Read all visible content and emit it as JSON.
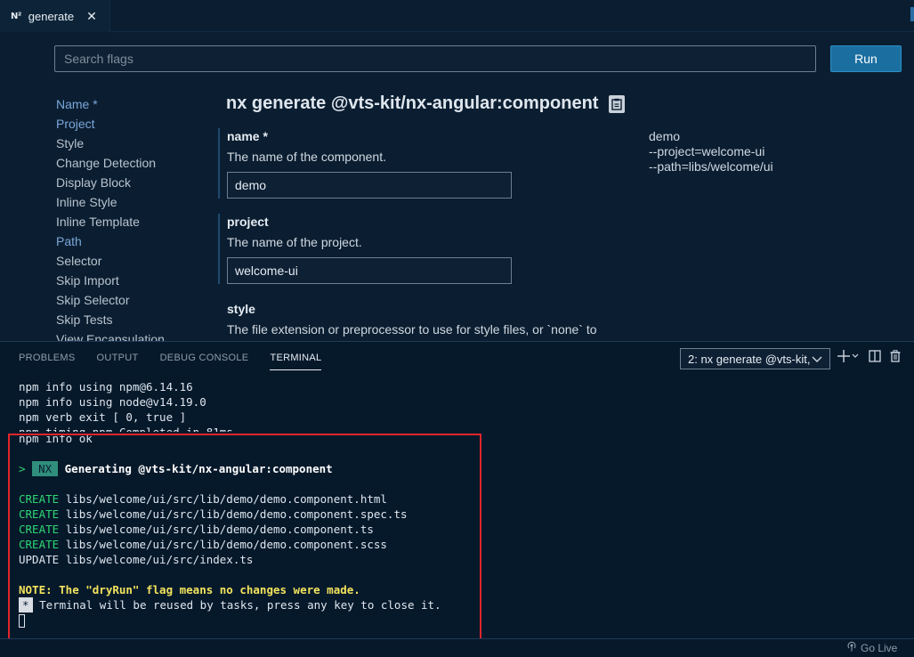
{
  "tab": {
    "logo": "N²",
    "label": "generate",
    "close": "✕"
  },
  "search": {
    "placeholder": "Search flags",
    "value": ""
  },
  "run_label": "Run",
  "nav": [
    "Name *",
    "Project",
    "Style",
    "Change Detection",
    "Display Block",
    "Inline Style",
    "Inline Template",
    "Path",
    "Selector",
    "Skip Import",
    "Skip Selector",
    "Skip Tests",
    "View Encapsulation"
  ],
  "nav_active": [
    "Name *",
    "Project",
    "Path"
  ],
  "title": "nx generate @vts-kit/nx-angular:component",
  "fields": [
    {
      "name": "name *",
      "description": "The name of the component.",
      "value": "demo"
    },
    {
      "name": "project",
      "description": "The name of the project.",
      "value": "welcome-ui"
    },
    {
      "name": "style",
      "description": "The file extension or preprocessor to use for style files, or `none` to skip generating the style file."
    }
  ],
  "preview": [
    "demo",
    "--project=welcome-ui",
    "--path=libs/welcome/ui"
  ],
  "panel_tabs": [
    "PROBLEMS",
    "OUTPUT",
    "DEBUG CONSOLE",
    "TERMINAL"
  ],
  "terminal_select": "2: nx generate @vts-kit,",
  "terminal_lines": [
    "npm info using npm@6.14.16",
    "npm info using node@v14.19.0",
    "npm verb exit [ 0, true ]",
    "npm timing npm Completed in 81ms",
    "npm info ok"
  ],
  "generating": {
    "prompt": ">",
    "badge": "NX",
    "text": "Generating @vts-kit/nx-angular:component"
  },
  "file_ops": [
    {
      "op": "CREATE",
      "path": "libs/welcome/ui/src/lib/demo/demo.component.html"
    },
    {
      "op": "CREATE",
      "path": "libs/welcome/ui/src/lib/demo/demo.component.spec.ts"
    },
    {
      "op": "CREATE",
      "path": "libs/welcome/ui/src/lib/demo/demo.component.ts"
    },
    {
      "op": "CREATE",
      "path": "libs/welcome/ui/src/lib/demo/demo.component.scss"
    },
    {
      "op": "UPDATE",
      "path": "libs/welcome/ui/src/index.ts"
    }
  ],
  "note": "NOTE: The \"dryRun\" flag means no changes were made.",
  "reuse": {
    "badge": "*",
    "text": "Terminal will be reused by tasks, press any key to close it."
  },
  "statusbar": {
    "golive": "Go Live"
  },
  "colors": {
    "accent": "#1b6fa0",
    "create": "#2fd672",
    "note": "#f2e35c",
    "highlight": "#e0252b"
  }
}
